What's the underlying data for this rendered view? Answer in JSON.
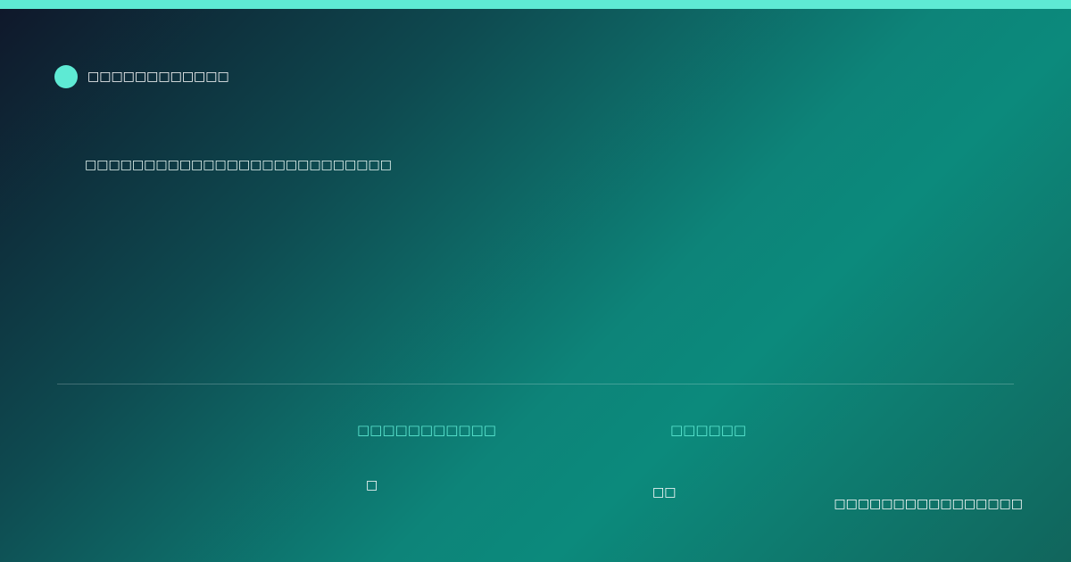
{
  "brand": {
    "name": "□□□□□□□□□□□□"
  },
  "headline": "□□□□□□□□□□□□□□□□□□□□□□□□□□",
  "stats": [
    {
      "label": "□□□□□□□□□□□",
      "value": "□"
    },
    {
      "label": "□□□□□□",
      "value": "□□"
    }
  ],
  "footer": {
    "text": "□□□□□□□□□□□□□□□□"
  },
  "colors": {
    "accent": "#5eead4",
    "background_start": "#0f172a",
    "background_mid": "#0d8479",
    "background_end": "#11655c"
  }
}
